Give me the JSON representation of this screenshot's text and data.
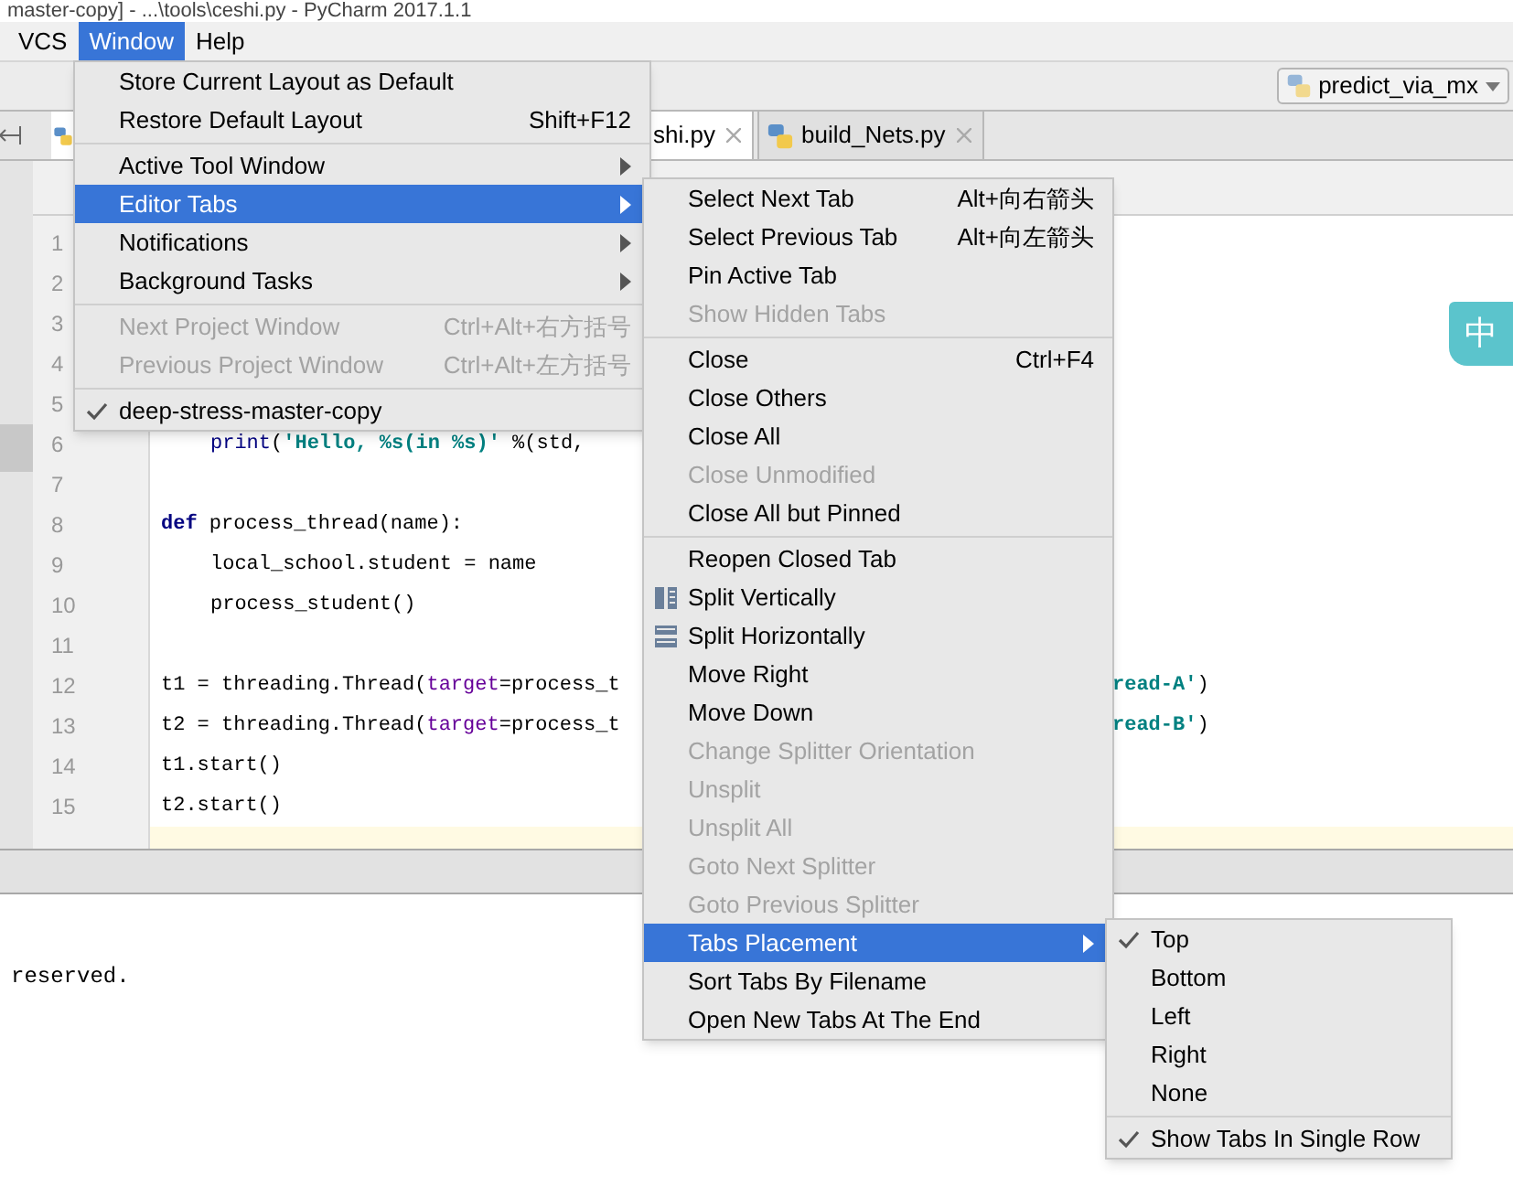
{
  "window": {
    "title": "master-copy] - ...\\tools\\ceshi.py - PyCharm 2017.1.1"
  },
  "menubar": [
    {
      "label": "VCS",
      "selected": false
    },
    {
      "label": "Window",
      "selected": true
    },
    {
      "label": "Help",
      "selected": false
    }
  ],
  "run_config": {
    "label": "predict_via_mx"
  },
  "tabs": [
    {
      "label": "shi.py",
      "selected": true
    },
    {
      "label": "build_Nets.py",
      "selected": false
    }
  ],
  "editor": {
    "lines": [
      {
        "number": "1"
      },
      {
        "number": "2"
      },
      {
        "number": "3"
      },
      {
        "number": "4"
      },
      {
        "number": "5"
      },
      {
        "number": "6",
        "indent": true,
        "tokens": [
          {
            "text": "print",
            "kind": "builtin"
          },
          {
            "text": "(",
            "kind": "plain"
          },
          {
            "text": "'Hello, %s(in %s)'",
            "kind": "string"
          },
          {
            "text": " %(std,",
            "kind": "plain"
          }
        ]
      },
      {
        "number": "7"
      },
      {
        "number": "8",
        "tokens": [
          {
            "text": "def",
            "kind": "keyword"
          },
          {
            "text": " process_thread(name):",
            "kind": "plain"
          }
        ]
      },
      {
        "number": "9",
        "indent": true,
        "tokens": [
          {
            "text": "local_school.student = name",
            "kind": "plain"
          }
        ]
      },
      {
        "number": "10",
        "indent": true,
        "tokens": [
          {
            "text": "process_student()",
            "kind": "plain"
          }
        ]
      },
      {
        "number": "11"
      },
      {
        "number": "12",
        "tokens": [
          {
            "text": "t1 = threading.Thread(",
            "kind": "plain"
          },
          {
            "text": "target",
            "kind": "param"
          },
          {
            "text": "=process_t",
            "kind": "plain"
          }
        ],
        "tail": [
          {
            "text": "read-A'",
            "kind": "string"
          },
          {
            "text": ")",
            "kind": "plain"
          }
        ]
      },
      {
        "number": "13",
        "tokens": [
          {
            "text": "t2 = threading.Thread(",
            "kind": "plain"
          },
          {
            "text": "target",
            "kind": "param"
          },
          {
            "text": "=process_t",
            "kind": "plain"
          }
        ],
        "tail": [
          {
            "text": "read-B'",
            "kind": "string"
          },
          {
            "text": ")",
            "kind": "plain"
          }
        ]
      },
      {
        "number": "14",
        "tokens": [
          {
            "text": "t1.start()",
            "kind": "plain"
          }
        ]
      },
      {
        "number": "15",
        "tokens": [
          {
            "text": "t2.start()",
            "kind": "plain"
          }
        ]
      }
    ]
  },
  "output": {
    "text": "reserved."
  },
  "ime_badge": "中",
  "window_menu": [
    {
      "kind": "item",
      "label": "Store Current Layout as Default",
      "selected": false,
      "disabled": false,
      "checked": false
    },
    {
      "kind": "item",
      "label": "Restore Default Layout",
      "shortcut": "Shift+F12",
      "selected": false,
      "disabled": false,
      "checked": false
    },
    {
      "kind": "separator"
    },
    {
      "kind": "item",
      "label": "Active Tool Window",
      "submenu": true,
      "selected": false,
      "disabled": false,
      "checked": false
    },
    {
      "kind": "item",
      "label": "Editor Tabs",
      "submenu": true,
      "selected": true,
      "disabled": false,
      "checked": false
    },
    {
      "kind": "item",
      "label": "Notifications",
      "submenu": true,
      "selected": false,
      "disabled": false,
      "checked": false
    },
    {
      "kind": "item",
      "label": "Background Tasks",
      "submenu": true,
      "selected": false,
      "disabled": false,
      "checked": false
    },
    {
      "kind": "separator"
    },
    {
      "kind": "item",
      "label": "Next Project Window",
      "shortcut": "Ctrl+Alt+右方括号",
      "selected": false,
      "disabled": true,
      "checked": false
    },
    {
      "kind": "item",
      "label": "Previous Project Window",
      "shortcut": "Ctrl+Alt+左方括号",
      "selected": false,
      "disabled": true,
      "checked": false
    },
    {
      "kind": "separator"
    },
    {
      "kind": "item",
      "label": "deep-stress-master-copy",
      "selected": false,
      "disabled": false,
      "checked": true
    }
  ],
  "editor_tabs_menu": [
    {
      "kind": "item",
      "label": "Select Next Tab",
      "shortcut": "Alt+向右箭头",
      "selected": false,
      "disabled": false
    },
    {
      "kind": "item",
      "label": "Select Previous Tab",
      "shortcut": "Alt+向左箭头",
      "selected": false,
      "disabled": false
    },
    {
      "kind": "item",
      "label": "Pin Active Tab",
      "selected": false,
      "disabled": false
    },
    {
      "kind": "item",
      "label": "Show Hidden Tabs",
      "selected": false,
      "disabled": true
    },
    {
      "kind": "separator"
    },
    {
      "kind": "item",
      "label": "Close",
      "shortcut": "Ctrl+F4",
      "selected": false,
      "disabled": false
    },
    {
      "kind": "item",
      "label": "Close Others",
      "selected": false,
      "disabled": false
    },
    {
      "kind": "item",
      "label": "Close All",
      "selected": false,
      "disabled": false
    },
    {
      "kind": "item",
      "label": "Close Unmodified",
      "selected": false,
      "disabled": true
    },
    {
      "kind": "item",
      "label": "Close All but Pinned",
      "selected": false,
      "disabled": false
    },
    {
      "kind": "separator"
    },
    {
      "kind": "item",
      "label": "Reopen Closed Tab",
      "selected": false,
      "disabled": false
    },
    {
      "kind": "vsplit",
      "label": "Split Vertically",
      "selected": false,
      "disabled": false
    },
    {
      "kind": "hsplit",
      "label": "Split Horizontally",
      "selected": false,
      "disabled": false
    },
    {
      "kind": "item",
      "label": "Move Right",
      "selected": false,
      "disabled": false
    },
    {
      "kind": "item",
      "label": "Move Down",
      "selected": false,
      "disabled": false
    },
    {
      "kind": "item",
      "label": "Change Splitter Orientation",
      "selected": false,
      "disabled": true
    },
    {
      "kind": "item",
      "label": "Unsplit",
      "selected": false,
      "disabled": true
    },
    {
      "kind": "item",
      "label": "Unsplit All",
      "selected": false,
      "disabled": true
    },
    {
      "kind": "item",
      "label": "Goto Next Splitter",
      "selected": false,
      "disabled": true
    },
    {
      "kind": "item",
      "label": "Goto Previous Splitter",
      "selected": false,
      "disabled": true
    },
    {
      "kind": "item",
      "label": "Tabs Placement",
      "submenu": true,
      "selected": true,
      "disabled": false
    },
    {
      "kind": "item",
      "label": "Sort Tabs By Filename",
      "selected": false,
      "disabled": false
    },
    {
      "kind": "item",
      "label": "Open New Tabs At The End",
      "selected": false,
      "disabled": false
    }
  ],
  "tabs_placement_menu": [
    {
      "kind": "item",
      "label": "Top",
      "checked": true,
      "selected": false
    },
    {
      "kind": "item",
      "label": "Bottom",
      "checked": false,
      "selected": false
    },
    {
      "kind": "item",
      "label": "Left",
      "checked": false,
      "selected": false
    },
    {
      "kind": "item",
      "label": "Right",
      "checked": false,
      "selected": false
    },
    {
      "kind": "item",
      "label": "None",
      "checked": false,
      "selected": false
    },
    {
      "kind": "separator"
    },
    {
      "kind": "item",
      "label": "Show Tabs In Single Row",
      "checked": true,
      "selected": false
    }
  ]
}
